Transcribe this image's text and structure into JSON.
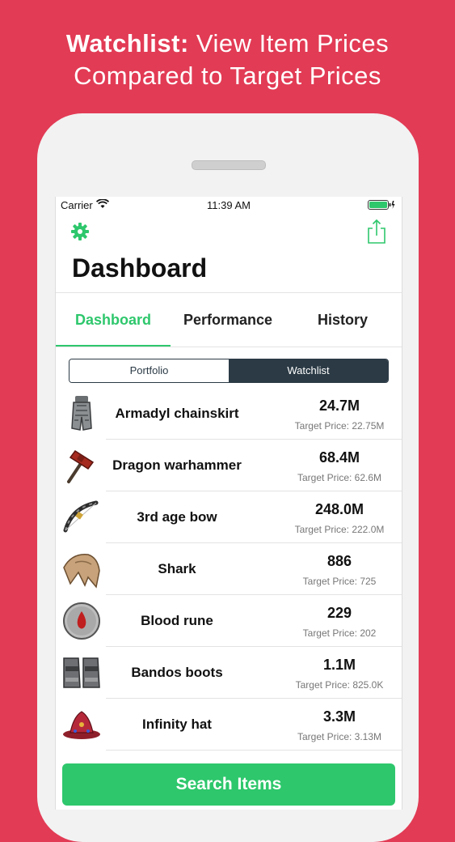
{
  "promo": {
    "title_bold": "Watchlist:",
    "title_rest": " View Item Prices",
    "title_line2": "Compared to Target Prices"
  },
  "status_bar": {
    "carrier": "Carrier",
    "time": "11:39 AM"
  },
  "header": {
    "title": "Dashboard"
  },
  "tabs": [
    {
      "label": "Dashboard",
      "active": true
    },
    {
      "label": "Performance",
      "active": false
    },
    {
      "label": "History",
      "active": false
    }
  ],
  "segmented": {
    "options": [
      "Portfolio",
      "Watchlist"
    ],
    "selected": "Watchlist"
  },
  "items": [
    {
      "name": "Armadyl chainskirt",
      "price": "24.7M",
      "target": "Target Price: 22.75M",
      "icon": "armadyl-chainskirt-icon"
    },
    {
      "name": "Dragon warhammer",
      "price": "68.4M",
      "target": "Target Price: 62.6M",
      "icon": "dragon-warhammer-icon"
    },
    {
      "name": "3rd age bow",
      "price": "248.0M",
      "target": "Target Price: 222.0M",
      "icon": "third-age-bow-icon"
    },
    {
      "name": "Shark",
      "price": "886",
      "target": "Target Price: 725",
      "icon": "shark-icon"
    },
    {
      "name": "Blood rune",
      "price": "229",
      "target": "Target Price: 202",
      "icon": "blood-rune-icon"
    },
    {
      "name": "Bandos boots",
      "price": "1.1M",
      "target": "Target Price: 825.0K",
      "icon": "bandos-boots-icon"
    },
    {
      "name": "Infinity hat",
      "price": "3.3M",
      "target": "Target Price: 3.13M",
      "icon": "infinity-hat-icon"
    }
  ],
  "search_button": {
    "label": "Search Items"
  },
  "colors": {
    "background": "#e23b55",
    "accent": "#2ec76c",
    "segmented_dark": "#2b3a45"
  }
}
